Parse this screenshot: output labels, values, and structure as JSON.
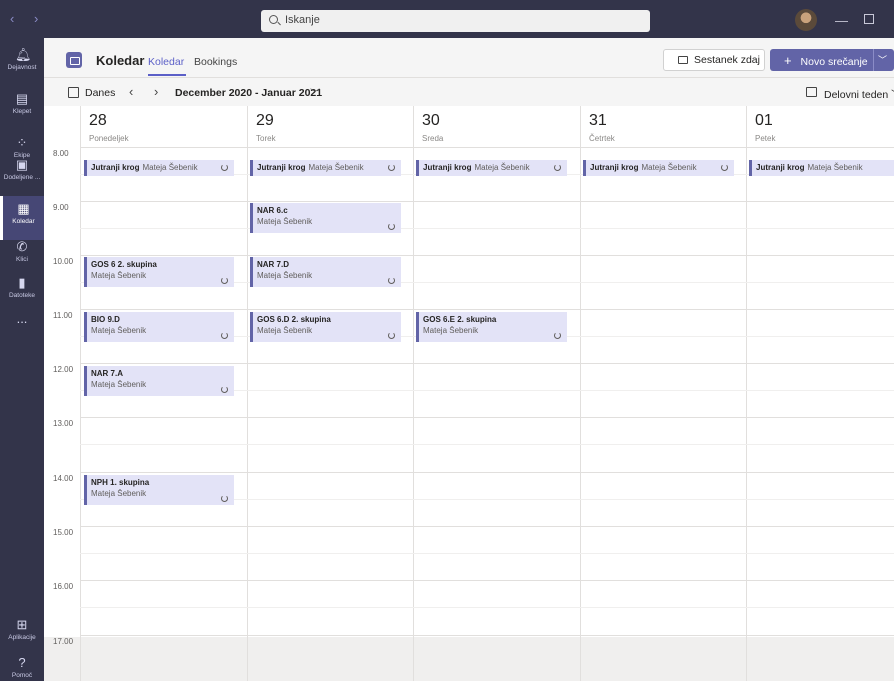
{
  "titlebar": {
    "search_placeholder": "Iskanje"
  },
  "rail": [
    {
      "label": "Dejavnost",
      "icon": "bell-icon"
    },
    {
      "label": "Klepet",
      "icon": "chat-icon"
    },
    {
      "label": "Ekipe",
      "icon": "teams-icon"
    },
    {
      "label": "Dodeljene ...",
      "icon": "assignments-icon"
    },
    {
      "label": "Koledar",
      "icon": "calendar-icon",
      "active": true
    },
    {
      "label": "Klici",
      "icon": "phone-icon"
    },
    {
      "label": "Datoteke",
      "icon": "files-icon"
    },
    {
      "label": "...",
      "icon": "more-icon"
    },
    {
      "label": "Aplikacije",
      "icon": "apps-icon"
    },
    {
      "label": "Pomoč",
      "icon": "help-icon"
    }
  ],
  "header": {
    "title": "Koledar",
    "tabs": [
      "Koledar",
      "Bookings"
    ],
    "meet_now": "Sestanek zdaj",
    "new_meeting": "Novo srečanje"
  },
  "toolbar": {
    "today": "Danes",
    "range": "December 2020 - Januar 2021",
    "view": "Delovni teden"
  },
  "days": [
    {
      "num": "28",
      "name": "Ponedeljek"
    },
    {
      "num": "29",
      "name": "Torek"
    },
    {
      "num": "30",
      "name": "Sreda"
    },
    {
      "num": "31",
      "name": "Četrtek"
    },
    {
      "num": "01",
      "name": "Petek"
    }
  ],
  "hours": [
    "8.00",
    "9.00",
    "10.00",
    "11.00",
    "12.00",
    "13.00",
    "14.00",
    "15.00",
    "16.00",
    "17.00"
  ],
  "events": [
    {
      "title": "Jutranji krog",
      "organizer": "Mateja Šebenik"
    },
    {
      "title": "Jutranji krog",
      "organizer": "Mateja Šebenik"
    },
    {
      "title": "Jutranji krog",
      "organizer": "Mateja Šebenik"
    },
    {
      "title": "Jutranji krog",
      "organizer": "Mateja Šebenik"
    },
    {
      "title": "Jutranji krog",
      "organizer": "Mateja Šebenik"
    },
    {
      "title": "NAR 6.c",
      "organizer": "Mateja Šebenik"
    },
    {
      "title": "GOS 6 2. skupina",
      "organizer": "Mateja Šebenik"
    },
    {
      "title": "NAR 7.D",
      "organizer": "Mateja Šebenik"
    },
    {
      "title": "BIO 9.D",
      "organizer": "Mateja Šebenik"
    },
    {
      "title": "GOS 6.D 2. skupina",
      "organizer": "Mateja Šebenik"
    },
    {
      "title": "GOS 6.E 2. skupina",
      "organizer": "Mateja Šebenik"
    },
    {
      "title": "NAR 7.A",
      "organizer": "Mateja Šebenik"
    },
    {
      "title": "NPH 1. skupina",
      "organizer": "Mateja Šebenik"
    }
  ]
}
